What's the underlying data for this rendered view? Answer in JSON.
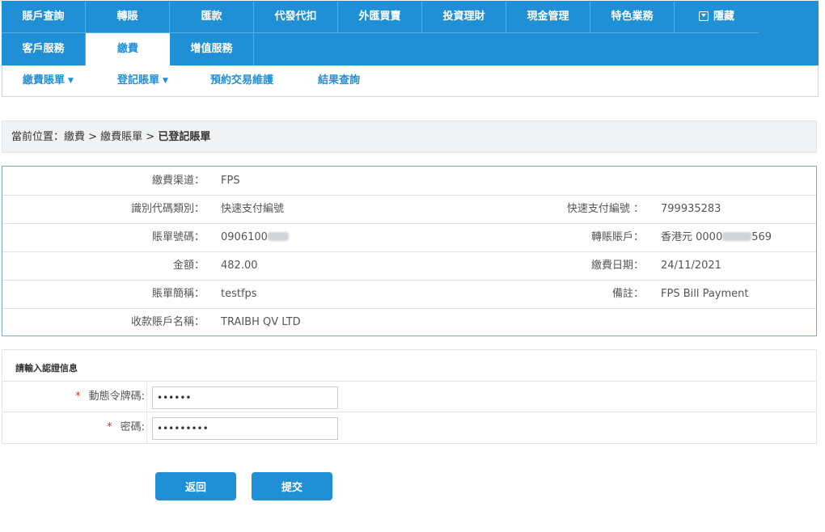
{
  "nav": {
    "row1": [
      "賬戶查詢",
      "轉賬",
      "匯款",
      "代發代扣",
      "外匯買賣",
      "投資理財",
      "現金管理",
      "特色業務",
      "隱藏"
    ],
    "row2": [
      "客戶服務",
      "繳費",
      "增值服務"
    ],
    "active": "繳費"
  },
  "subnav": [
    {
      "label": "繳費賬單",
      "caret": "▼"
    },
    {
      "label": "登記賬單",
      "caret": "▼"
    },
    {
      "label": "預約交易維護",
      "caret": ""
    },
    {
      "label": "結果查詢",
      "caret": ""
    }
  ],
  "breadcrumb": {
    "prefix": "當前位置：繳費 > 繳費賬單 > ",
    "current": "已登記賬單"
  },
  "details": {
    "channel_label": "繳費渠道：",
    "channel": "FPS",
    "id_type_label": "識別代碼類別：",
    "id_type": "快速支付編號",
    "fps_id_label": "快速支付編號 ：",
    "fps_id": "799935283",
    "bill_no_label": "賬單號碼：",
    "bill_no": "0906100",
    "transfer_account_label": "轉賬賬戶：",
    "transfer_account_prefix": "香港元 0000",
    "transfer_account_suffix": "569",
    "amount_label": "金額：",
    "amount": "482.00",
    "pay_date_label": "繳費日期：",
    "pay_date": "24/11/2021",
    "bill_name_label": "賬單簡稱：",
    "bill_name": "testfps",
    "remark_label": "備註：",
    "remark": "FPS Bill Payment",
    "payee_label": "收款賬戶名稱：",
    "payee": "TRAIBH QV LTD"
  },
  "auth": {
    "title": "請輸入認證信息",
    "required_mark": "*",
    "token_label": "動態令牌碼:",
    "token_value": "••••••",
    "password_label": "密碼:",
    "password_value": "•••••••••"
  },
  "buttons": {
    "back": "返回",
    "submit": "提交"
  },
  "colors": {
    "primary": "#1f8fd6",
    "required": "#c0392b"
  }
}
